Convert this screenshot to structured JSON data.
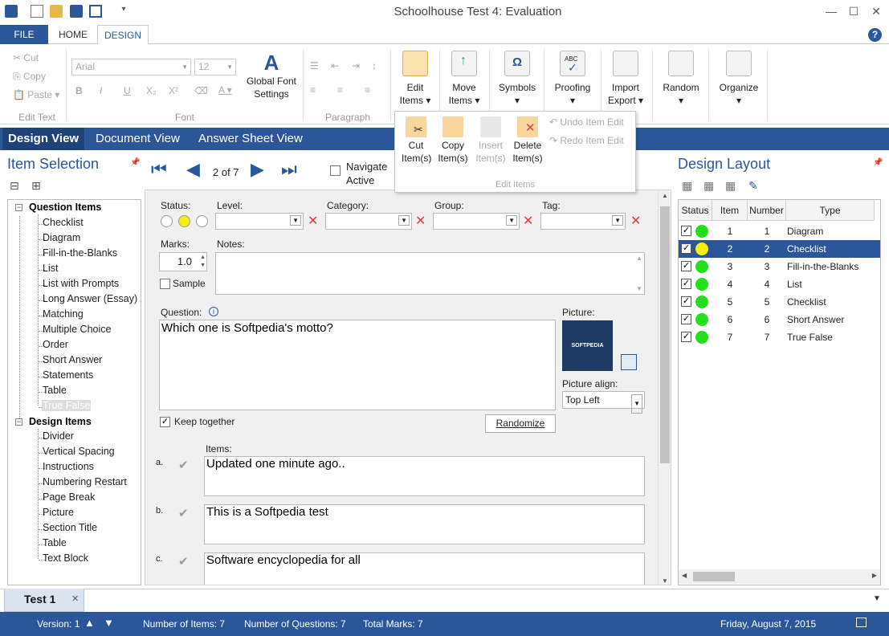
{
  "app": {
    "title": "Schoolhouse Test 4: Evaluation"
  },
  "ribbon_tabs": [
    "FILE",
    "HOME",
    "DESIGN"
  ],
  "ribbon": {
    "edit_text": {
      "cut": "Cut",
      "copy": "Copy",
      "paste": "Paste",
      "label": "Edit Text"
    },
    "font": {
      "family": "Arial",
      "size": "12",
      "label": "Font",
      "global_btn": "Global Font Settings"
    },
    "paragraph": {
      "label": "Paragraph"
    },
    "buttons": {
      "edit_items": "Edit Items",
      "move_items": "Move Items",
      "symbols": "Symbols",
      "proofing": "Proofing",
      "import_export": "Import Export",
      "random": "Random",
      "organize": "Organize"
    }
  },
  "edit_popup": {
    "cut": "Cut Item(s)",
    "copy": "Copy Item(s)",
    "insert": "Insert Item(s)",
    "delete": "Delete Item(s)",
    "undo": "Undo Item Edit",
    "redo": "Redo Item Edit",
    "group_label": "Edit Items"
  },
  "view_tabs": [
    "Design View",
    "Document View",
    "Answer Sheet View"
  ],
  "item_selection": {
    "title": "Item Selection",
    "question_items_label": "Question Items",
    "question_items": [
      "Checklist",
      "Diagram",
      "Fill-in-the-Blanks",
      "List",
      "List with Prompts",
      "Long Answer (Essay)",
      "Matching",
      "Multiple Choice",
      "Order",
      "Short Answer",
      "Statements",
      "Table",
      "True False"
    ],
    "design_items_label": "Design Items",
    "design_items": [
      "Divider",
      "Vertical Spacing",
      "Instructions",
      "Numbering Restart",
      "Page Break",
      "Picture",
      "Section Title",
      "Table",
      "Text Block"
    ]
  },
  "navigation": {
    "position": "2 of 7",
    "navigate_label": "Navigate Active"
  },
  "editor": {
    "status_label": "Status:",
    "level_label": "Level:",
    "category_label": "Category:",
    "group_label": "Group:",
    "tag_label": "Tag:",
    "marks_label": "Marks:",
    "marks_value": "1.0",
    "notes_label": "Notes:",
    "sample_label": "Sample",
    "question_label": "Question:",
    "question_text": "Which one is Softpedia's motto?",
    "picture_label": "Picture:",
    "picture_text": "SOFTPEDIA",
    "picture_align_label": "Picture align:",
    "picture_align_value": "Top Left",
    "keep_together_label": "Keep together",
    "randomize_btn": "Randomize",
    "items_label": "Items:",
    "items": [
      {
        "letter": "a.",
        "text": "Updated one minute ago.."
      },
      {
        "letter": "b.",
        "text": "This is a Softpedia test"
      },
      {
        "letter": "c.",
        "text": "Software encyclopedia for all"
      }
    ]
  },
  "design_layout": {
    "title": "Design Layout",
    "columns": [
      "Status",
      "Item",
      "Number",
      "Type"
    ],
    "rows": [
      {
        "item": "1",
        "number": "1",
        "type": "Diagram",
        "status": "green"
      },
      {
        "item": "2",
        "number": "2",
        "type": "Checklist",
        "status": "yellow"
      },
      {
        "item": "3",
        "number": "3",
        "type": "Fill-in-the-Blanks",
        "status": "green"
      },
      {
        "item": "4",
        "number": "4",
        "type": "List",
        "status": "green"
      },
      {
        "item": "5",
        "number": "5",
        "type": "Checklist",
        "status": "green"
      },
      {
        "item": "6",
        "number": "6",
        "type": "Short Answer",
        "status": "green"
      },
      {
        "item": "7",
        "number": "7",
        "type": "True False",
        "status": "green"
      }
    ]
  },
  "document_tab": "Test 1",
  "status_bar": {
    "version": "Version: 1",
    "num_items": "Number of Items: 7",
    "num_questions": "Number of Questions: 7",
    "total_marks": "Total Marks: 7",
    "date": "Friday, August 7, 2015"
  },
  "colors": {
    "accent": "#2b579a",
    "green": "#22e01a",
    "yellow": "#f7f00a",
    "red_x": "#d63e3e"
  }
}
